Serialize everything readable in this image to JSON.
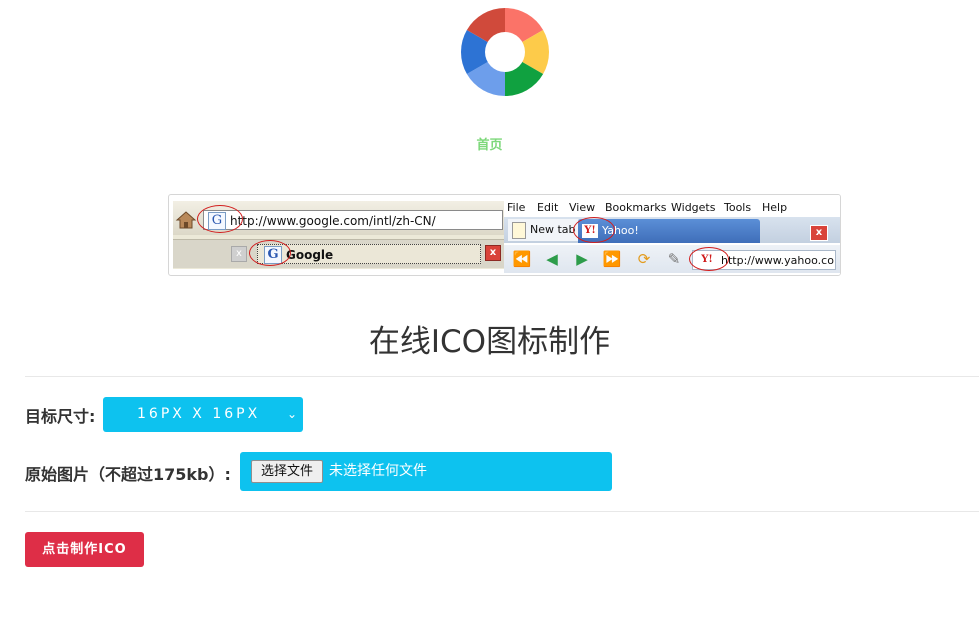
{
  "logo": {
    "colors": [
      "#fb7368",
      "#fdcb4a",
      "#10a140",
      "#6d9eeb",
      "#2d73d4",
      "#d04a3b"
    ]
  },
  "nav": {
    "home": "首页"
  },
  "demo": {
    "left": {
      "url": "http://www.google.com/intl/zh-CN/",
      "favicon": "G",
      "tab_title": "Google",
      "close": "x"
    },
    "right": {
      "menu": [
        "File",
        "Edit",
        "View",
        "Bookmarks",
        "Widgets",
        "Tools",
        "Help"
      ],
      "new_tab": "New tab",
      "yahoo_tab": "Yahoo!",
      "favicon": "Y!",
      "url": "http://www.yahoo.com",
      "close": "x"
    }
  },
  "title": "在线ICO图标制作",
  "form": {
    "size_label": "目标尺寸:",
    "size_value": "16PX X 16PX",
    "file_label": "原始图片（不超过175kb）:",
    "file_button": "选择文件",
    "file_status": "未选择任何文件"
  },
  "submit_label": "点击制作ICO"
}
